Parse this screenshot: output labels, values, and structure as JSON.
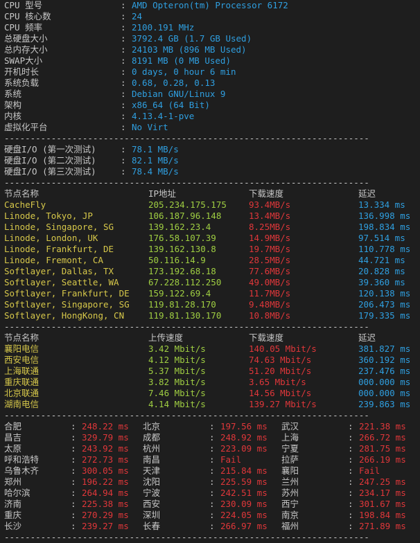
{
  "system": [
    {
      "label": "CPU 型号",
      "value": "AMD Opteron(tm) Processor 6172"
    },
    {
      "label": "CPU 核心数",
      "value": "24"
    },
    {
      "label": "CPU 频率",
      "value": "2100.191 MHz"
    },
    {
      "label": "总硬盘大小",
      "value": "3792.4 GB (1.7 GB Used)"
    },
    {
      "label": "总内存大小",
      "value": "24103 MB (896 MB Used)"
    },
    {
      "label": "SWAP大小",
      "value": "8191 MB (0 MB Used)"
    },
    {
      "label": "开机时长",
      "value": "0 days, 0 hour 6 min"
    },
    {
      "label": "系统负载",
      "value": "0.68, 0.28, 0.13"
    },
    {
      "label": "系统",
      "value": "Debian GNU/Linux 9"
    },
    {
      "label": "架构",
      "value": "x86_64 (64 Bit)"
    },
    {
      "label": "内核",
      "value": "4.13.4-1-pve"
    },
    {
      "label": "虚拟化平台",
      "value": "No Virt"
    }
  ],
  "separator": "----------------------------------------------------------------------",
  "disk_io": [
    {
      "label": "硬盘I/O (第一次测试)",
      "value": "78.1 MB/s"
    },
    {
      "label": "硬盘I/O (第二次测试)",
      "value": "82.1 MB/s"
    },
    {
      "label": "硬盘I/O (第三次测试)",
      "value": "78.4 MB/s"
    }
  ],
  "download": {
    "headers": [
      "节点名称",
      "IP地址",
      "下载速度",
      "延迟"
    ],
    "rows": [
      [
        "CacheFly",
        "205.234.175.175",
        "93.4MB/s",
        "13.334 ms"
      ],
      [
        "Linode, Tokyo, JP",
        "106.187.96.148",
        "13.4MB/s",
        "136.998 ms"
      ],
      [
        "Linode, Singapore, SG",
        "139.162.23.4",
        "8.25MB/s",
        "198.834 ms"
      ],
      [
        "Linode, London, UK",
        "176.58.107.39",
        "14.9MB/s",
        "97.514 ms"
      ],
      [
        "Linode, Frankfurt, DE",
        "139.162.130.8",
        "19.7MB/s",
        "110.778 ms"
      ],
      [
        "Linode, Fremont, CA",
        "50.116.14.9",
        "28.5MB/s",
        "44.721 ms"
      ],
      [
        "Softlayer, Dallas, TX",
        "173.192.68.18",
        "77.6MB/s",
        "20.828 ms"
      ],
      [
        "Softlayer, Seattle, WA",
        "67.228.112.250",
        "49.0MB/s",
        "39.360 ms"
      ],
      [
        "Softlayer, Frankfurt, DE",
        "159.122.69.4",
        "11.7MB/s",
        "120.138 ms"
      ],
      [
        "Softlayer, Singapore, SG",
        "119.81.28.170",
        "9.48MB/s",
        "206.473 ms"
      ],
      [
        "Softlayer, HongKong, CN",
        "119.81.130.170",
        "10.8MB/s",
        "179.335 ms"
      ]
    ]
  },
  "china_speed": {
    "headers": [
      "节点名称",
      "上传速度",
      "下载速度",
      "延迟"
    ],
    "rows": [
      [
        "襄阳电信",
        "3.42 Mbit/s",
        "140.05 Mbit/s",
        "381.827 ms"
      ],
      [
        "西安电信",
        "4.12 Mbit/s",
        "74.63 Mbit/s",
        "360.192 ms"
      ],
      [
        "上海联通",
        "5.37 Mbit/s",
        "51.20 Mbit/s",
        "237.476 ms"
      ],
      [
        "重庆联通",
        "3.82 Mbit/s",
        "3.65 Mbit/s",
        "000.000 ms"
      ],
      [
        "北京联通",
        "7.46 Mbit/s",
        "14.56 Mbit/s",
        "000.000 ms"
      ],
      [
        "湖南电信",
        "4.14 Mbit/s",
        "139.27 Mbit/s",
        "239.863 ms"
      ]
    ]
  },
  "ping": [
    [
      [
        "合肥",
        "248.22 ms"
      ],
      [
        "北京",
        "197.56 ms"
      ],
      [
        "武汉",
        "221.38 ms"
      ]
    ],
    [
      [
        "昌吉",
        "329.79 ms"
      ],
      [
        "成都",
        "248.92 ms"
      ],
      [
        "上海",
        "266.72 ms"
      ]
    ],
    [
      [
        "太原",
        "243.92 ms"
      ],
      [
        "杭州",
        "223.09 ms"
      ],
      [
        "宁夏",
        "281.75 ms"
      ]
    ],
    [
      [
        "呼和浩特",
        "272.73 ms"
      ],
      [
        "南昌",
        "Fail"
      ],
      [
        "拉萨",
        "266.19 ms"
      ]
    ],
    [
      [
        "乌鲁木齐",
        "300.05 ms"
      ],
      [
        "天津",
        "215.84 ms"
      ],
      [
        "襄阳",
        "Fail"
      ]
    ],
    [
      [
        "郑州",
        "196.22 ms"
      ],
      [
        "沈阳",
        "225.59 ms"
      ],
      [
        "兰州",
        "247.25 ms"
      ]
    ],
    [
      [
        "哈尔滨",
        "264.94 ms"
      ],
      [
        "宁波",
        "242.51 ms"
      ],
      [
        "苏州",
        "234.17 ms"
      ]
    ],
    [
      [
        "济南",
        "225.38 ms"
      ],
      [
        "西安",
        "230.09 ms"
      ],
      [
        "西宁",
        "301.67 ms"
      ]
    ],
    [
      [
        "重庆",
        "270.29 ms"
      ],
      [
        "深圳",
        "224.05 ms"
      ],
      [
        "南京",
        "198.84 ms"
      ]
    ],
    [
      [
        "长沙",
        "239.27 ms"
      ],
      [
        "长春",
        "266.97 ms"
      ],
      [
        "福州",
        "271.89 ms"
      ]
    ]
  ],
  "colors": {
    "background": "#1e1e1e",
    "text": "#c8c8c8",
    "value_blue": "#2f9fe0",
    "ip_green": "#9fce42",
    "speed_red": "#e0373a",
    "node_yellow": "#d7c84a"
  }
}
